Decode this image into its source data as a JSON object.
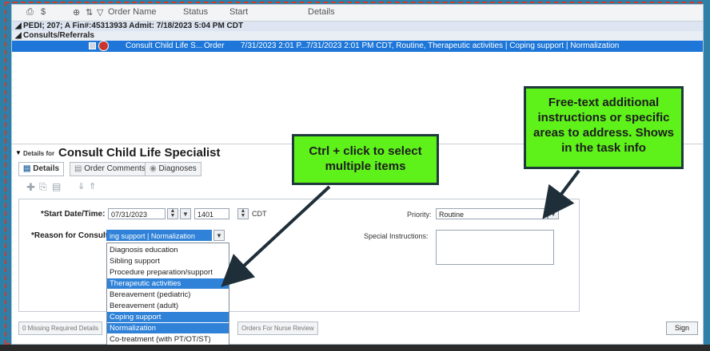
{
  "grid": {
    "headers": {
      "col_s": "$",
      "order_name": "Order Name",
      "status": "Status",
      "start": "Start",
      "details": "Details"
    },
    "patient_row": "PEDI; 207; A  Fin#:45313933  Admit: 7/18/2023 5:04 PM CDT",
    "category_row": "Consults/Referrals",
    "order_row": {
      "name": "Consult Child Life S...",
      "status": "Order",
      "start": "7/31/2023 2:01 P...",
      "details": "7/31/2023 2:01 PM CDT, Routine, Therapeutic activities | Coping support | Normalization"
    }
  },
  "details": {
    "prefix": "Details for",
    "title": "Consult Child Life Specialist",
    "tabs": [
      "Details",
      "Order Comments",
      "Diagnoses"
    ]
  },
  "form": {
    "start_label": "*Start Date/Time:",
    "start_date": "07/31/2023",
    "start_time": "1401",
    "tz": "CDT",
    "reason_label": "*Reason for Consult:",
    "reason_value": "ing support | Normalization",
    "priority_label": "Priority:",
    "priority_value": "Routine",
    "special_label": "Special Instructions:"
  },
  "reason_options": [
    {
      "label": "Diagnosis education",
      "selected": false
    },
    {
      "label": "Sibling support",
      "selected": false
    },
    {
      "label": "Procedure preparation/support",
      "selected": false
    },
    {
      "label": "Therapeutic activities",
      "selected": true
    },
    {
      "label": "Bereavement (pediatric)",
      "selected": false
    },
    {
      "label": "Bereavement (adult)",
      "selected": false
    },
    {
      "label": "Coping support",
      "selected": true
    },
    {
      "label": "Normalization",
      "selected": true
    },
    {
      "label": "Co-treatment (with PT/OT/ST)",
      "selected": false
    }
  ],
  "footer": {
    "missing": "0 Missing Required Details",
    "nurse_review": "Orders For Nurse Review",
    "sign": "Sign"
  },
  "callouts": {
    "ctrl_click": "Ctrl + click to select multiple items",
    "free_text": "Free-text additional instructions or specific areas to address. Shows in the task info"
  },
  "colors": {
    "callout_fill": "#5ef11a",
    "selected_row": "#1e77d8",
    "frame": "#2f80a8"
  }
}
